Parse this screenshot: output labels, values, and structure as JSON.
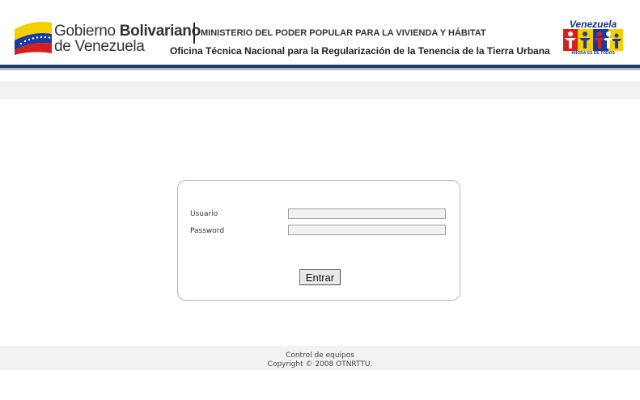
{
  "header": {
    "gov_name_part1": "Gobierno ",
    "gov_name_part2": "Bolivariano",
    "gov_name_line2": "de Venezuela",
    "ministry": "MINISTERIO DEL PODER POPULAR PARA LA VIVIENDA Y HÁBITAT",
    "office": "Oficina Técnica Nacional para la Regularización de la Tenencia de la Tierra Urbana",
    "right_logo_title": "Venezuela",
    "right_logo_subtitle": "AHORA ES DE TODOS"
  },
  "login": {
    "user_label": "Usuario",
    "user_value": "",
    "password_label": "Password",
    "password_value": "",
    "submit_label": "Entrar"
  },
  "footer": {
    "line1": "Control de equipos",
    "line2": "Copyright © 2008 OTNRTTU."
  },
  "colors": {
    "header_band": "#1c3b66",
    "header_band_light": "#aeb8c6",
    "flag_yellow": "#f5d000",
    "flag_blue": "#1a3aa0",
    "flag_red": "#d62020",
    "footer_bg": "#f2f2f2"
  }
}
